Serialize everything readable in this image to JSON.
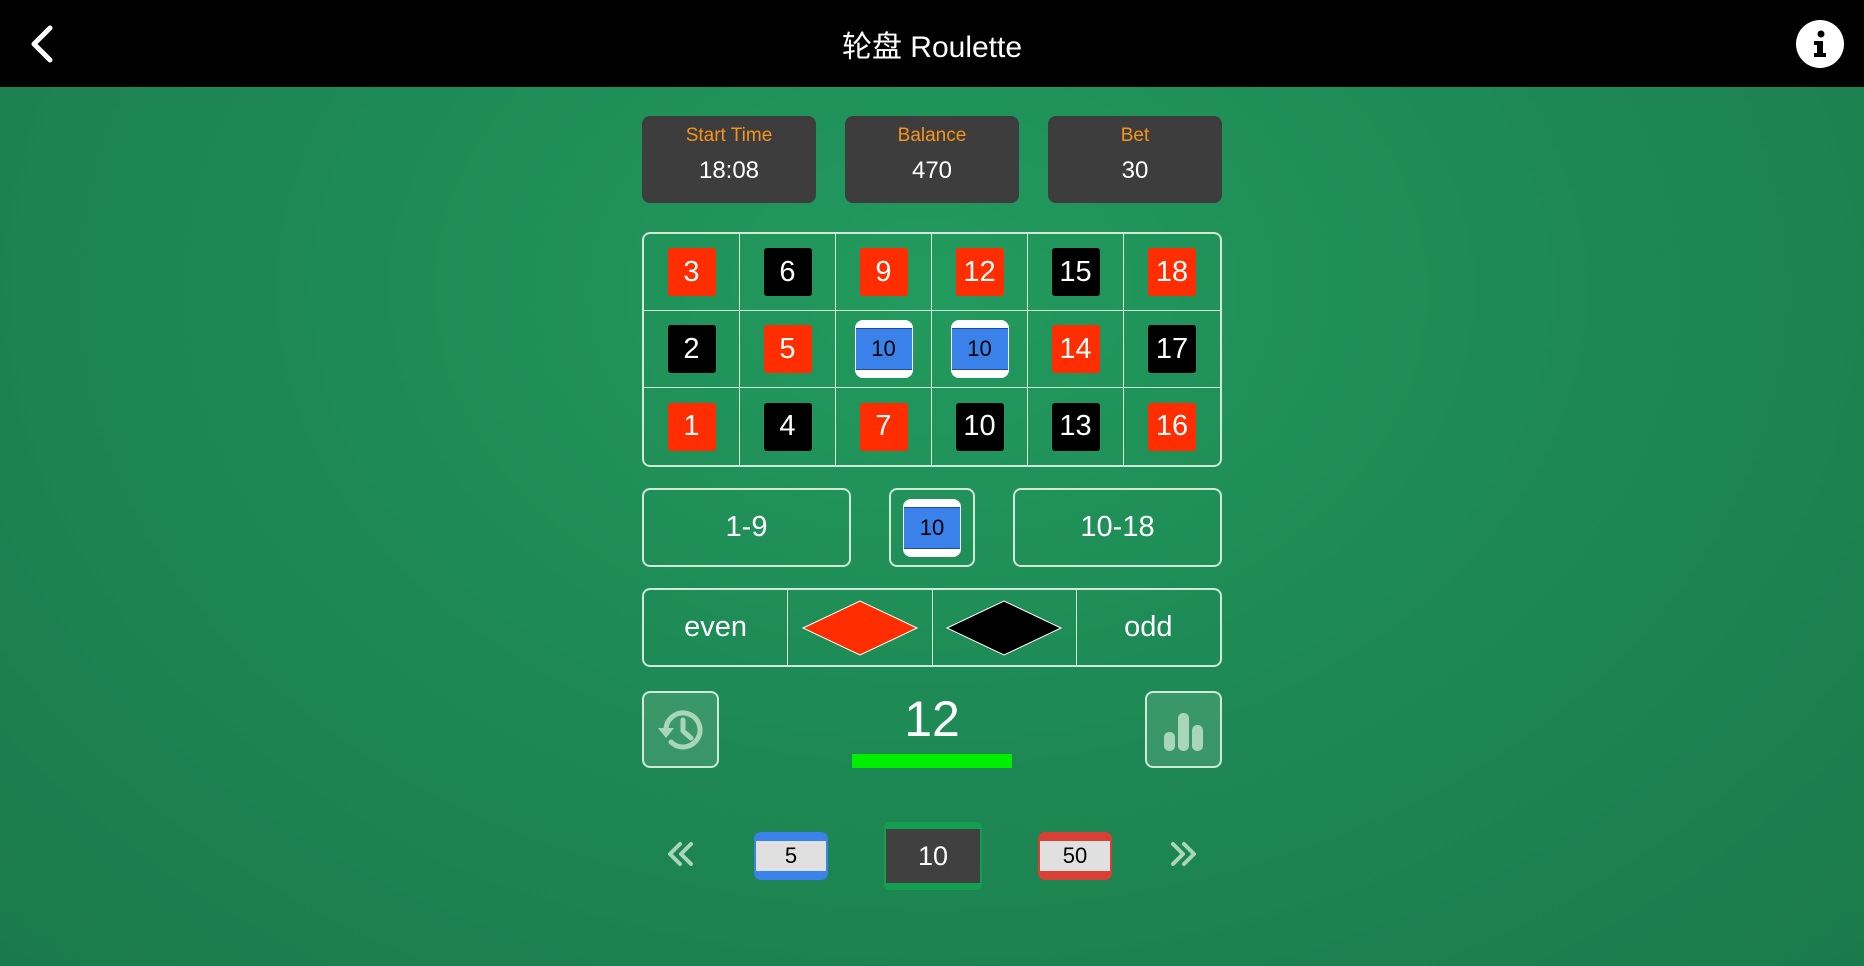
{
  "header": {
    "title": "轮盘 Roulette"
  },
  "stats": [
    {
      "label": "Start Time",
      "value": "18:08"
    },
    {
      "label": "Balance",
      "value": "470"
    },
    {
      "label": "Bet",
      "value": "30"
    }
  ],
  "colors": {
    "red": "#ff2d00",
    "black": "#000000",
    "chip_blue": "#3a82ea",
    "chip_red": "#d94035",
    "chip_selected": "#404040",
    "result_bar": "#00ee00",
    "label_orange": "#f7941d"
  },
  "board": {
    "rows": [
      [
        {
          "n": "3",
          "color": "red"
        },
        {
          "n": "6",
          "color": "black"
        },
        {
          "n": "9",
          "color": "red"
        },
        {
          "n": "12",
          "color": "red"
        },
        {
          "n": "15",
          "color": "black"
        },
        {
          "n": "18",
          "color": "red"
        }
      ],
      [
        {
          "n": "2",
          "color": "black"
        },
        {
          "n": "5",
          "color": "red"
        },
        {
          "chip": "10"
        },
        {
          "chip": "10"
        },
        {
          "n": "14",
          "color": "red"
        },
        {
          "n": "17",
          "color": "black"
        }
      ],
      [
        {
          "n": "1",
          "color": "red"
        },
        {
          "n": "4",
          "color": "black"
        },
        {
          "n": "7",
          "color": "red"
        },
        {
          "n": "10",
          "color": "black"
        },
        {
          "n": "13",
          "color": "black"
        },
        {
          "n": "16",
          "color": "red"
        }
      ]
    ]
  },
  "ranges": {
    "low": "1-9",
    "middle_chip": "10",
    "high": "10-18"
  },
  "parity": {
    "even": "even",
    "odd": "odd"
  },
  "result": {
    "number": "12"
  },
  "chips": {
    "left": "5",
    "selected": "10",
    "right": "50"
  }
}
